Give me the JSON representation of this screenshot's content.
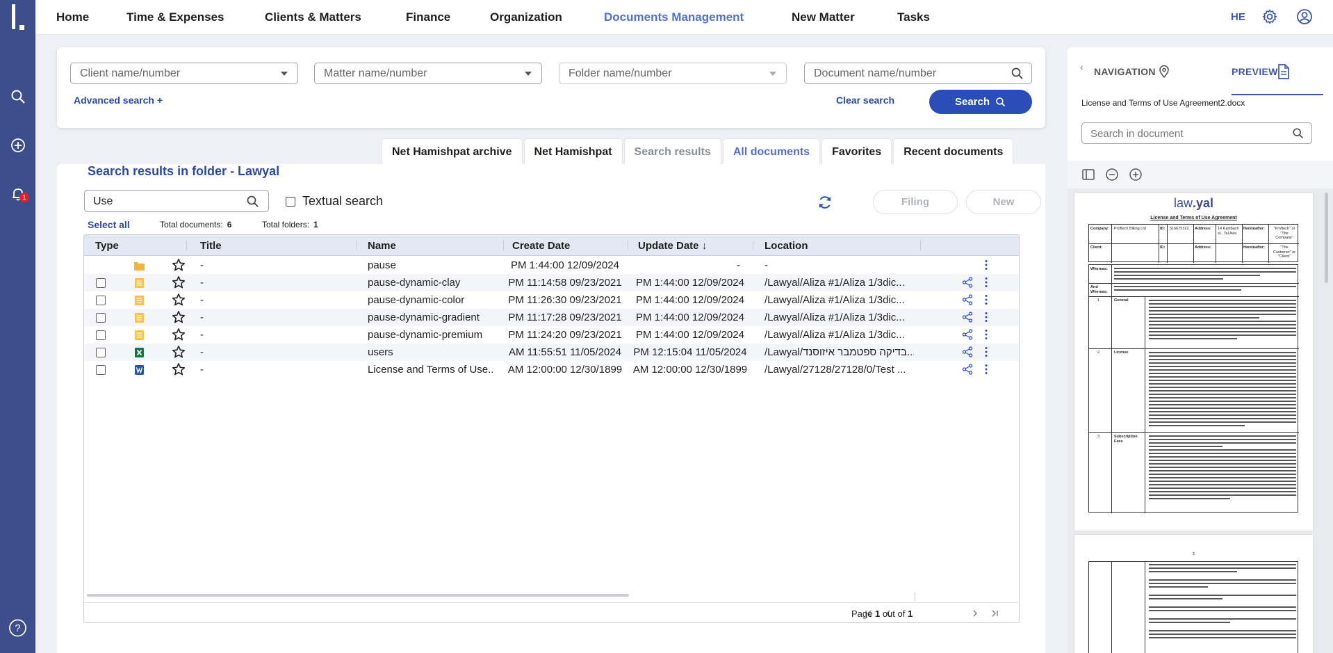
{
  "nav": {
    "items": [
      "Home",
      "Time & Expenses",
      "Clients & Matters",
      "Finance",
      "Organization",
      "Documents Management",
      "New Matter",
      "Tasks"
    ],
    "active_index": 5,
    "user_initials": "HE",
    "icons": [
      "gear-icon",
      "account-icon"
    ]
  },
  "sidebar": {
    "icons": [
      "search-icon",
      "add-icon",
      "bell-icon",
      "help-icon"
    ],
    "notification_count": "1"
  },
  "search": {
    "client_placeholder": "Client name/number",
    "matter_placeholder": "Matter name/number",
    "folder_placeholder": "Folder name/number",
    "document_placeholder": "Document name/number",
    "advanced_label": "Advanced search  +",
    "clear_label": "Clear search",
    "search_label": "Search"
  },
  "tabs": [
    {
      "label": "Net Hamishpat archive",
      "state": "normal"
    },
    {
      "label": "Net Hamishpat",
      "state": "normal"
    },
    {
      "label": "Search results",
      "state": "grey"
    },
    {
      "label": "All documents",
      "state": "active"
    },
    {
      "label": "Favorites",
      "state": "normal"
    },
    {
      "label": "Recent documents",
      "state": "normal"
    }
  ],
  "results": {
    "heading": "Search results in folder - Lawyal",
    "filter_value": "Use",
    "textual_label": "Textual search",
    "filing_label": "Filing",
    "new_label": "New",
    "select_all_label": "Select all",
    "total_documents_label": "Total documents:",
    "total_documents": "6",
    "total_folders_label": "Total folders:",
    "total_folders": "1"
  },
  "table": {
    "columns": [
      "Type",
      "Title",
      "Name",
      "Create Date",
      "Update Date",
      "Location"
    ],
    "sort_indicator": "↓",
    "rows": [
      {
        "type": "folder",
        "title": "-",
        "name": "pause",
        "create": "PM 1:44:00 12/09/2024",
        "update": "-",
        "location": "-"
      },
      {
        "type": "doc",
        "title": "-",
        "name": "pause-dynamic-clay",
        "create": "PM 11:14:58 09/23/2021",
        "update": "PM 1:44:00 12/09/2024",
        "location": "/Lawyal/Aliza #1/Aliza 1/3dic..."
      },
      {
        "type": "doc",
        "title": "-",
        "name": "pause-dynamic-color",
        "create": "PM 11:26:30 09/23/2021",
        "update": "PM 1:44:00 12/09/2024",
        "location": "/Lawyal/Aliza #1/Aliza 1/3dic..."
      },
      {
        "type": "doc",
        "title": "-",
        "name": "pause-dynamic-gradient",
        "create": "PM 11:17:28 09/23/2021",
        "update": "PM 1:44:00 12/09/2024",
        "location": "/Lawyal/Aliza #1/Aliza 1/3dic..."
      },
      {
        "type": "doc",
        "title": "-",
        "name": "pause-dynamic-premium",
        "create": "PM 11:24:20 09/23/2021",
        "update": "PM 1:44:00 12/09/2024",
        "location": "/Lawyal/Aliza #1/Aliza 1/3dic..."
      },
      {
        "type": "excel",
        "title": "-",
        "name": "users",
        "create": "AM 11:55:51 11/05/2024",
        "update": "PM 12:15:04 11/05/2024",
        "location": "/Lawyal/בדיקה ספטמבר איזוסנד..."
      },
      {
        "type": "word",
        "title": "-",
        "name": "License and Terms of Use...",
        "create": "AM 12:00:00 12/30/1899",
        "update": "AM 12:00:00 12/30/1899",
        "location": "/Lawyal/27128/27128/0/Test ..."
      }
    ],
    "pager_prefix": "Page ",
    "pager_page": "1",
    "pager_mid": " out of ",
    "pager_total": "1"
  },
  "preview": {
    "navigation_label": "NAVIGATION",
    "preview_label": "PREVIEW",
    "file_name": "License and Terms of Use Agreement2.docx",
    "search_placeholder": "Search in document",
    "doc": {
      "logo_law": "law",
      "logo_yal": ".yal",
      "title": "License and Terms of Use Agreement",
      "company_label": "Company:",
      "company_value": "Proftech Billing Ltd",
      "id_label": "ID:",
      "id_value": "516675322",
      "address_label": "Address:",
      "address_value": "14 Karlibach st., Tel Aviv",
      "hereinafter_label": "Hereinafter:",
      "hereinafter_company": "\"Proftech\" or \"The Company\"",
      "client_label": "Client:",
      "hereinafter_customer": "\"The Customer\" or \"Client\"",
      "whereas_label": "Whereas:",
      "and_whereas_label": "And Whereas:",
      "section1_num": "1",
      "section1_title": "General",
      "section2_num": "2",
      "section2_title": "License",
      "section3_num": "3",
      "section3_title": "Subscription Fees",
      "page2_num": "2"
    }
  }
}
